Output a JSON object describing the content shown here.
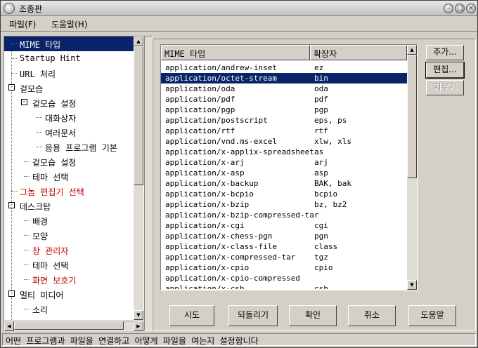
{
  "window": {
    "title": "조종판"
  },
  "menu": [
    "파일(F)",
    "도움말(H)"
  ],
  "tree": [
    {
      "label": "MIME 타입",
      "level": 0,
      "selected": true
    },
    {
      "label": "Startup Hint",
      "level": 0
    },
    {
      "label": "URL 처리",
      "level": 0
    },
    {
      "label": "겉모습",
      "level": 0,
      "expander": "-"
    },
    {
      "label": "겉모습 설정",
      "level": 1,
      "expander": "-"
    },
    {
      "label": "대화상자",
      "level": 2
    },
    {
      "label": "여러문서",
      "level": 2
    },
    {
      "label": "응용 프로그램 기본",
      "level": 2
    },
    {
      "label": "겉모습 설정",
      "level": 1
    },
    {
      "label": "테마 선택",
      "level": 1
    },
    {
      "label": "그놈 편집기 선택",
      "level": 0,
      "red": true
    },
    {
      "label": "데스크탑",
      "level": 0,
      "expander": "-"
    },
    {
      "label": "배경",
      "level": 1
    },
    {
      "label": "모양",
      "level": 1
    },
    {
      "label": "창 관리자",
      "level": 1,
      "red": true
    },
    {
      "label": "테마 선택",
      "level": 1
    },
    {
      "label": "화면 보호기",
      "level": 1,
      "red": true
    },
    {
      "label": "멀티 미디어",
      "level": 0,
      "expander": "-"
    },
    {
      "label": "소리",
      "level": 1
    }
  ],
  "mime_table": {
    "headers": [
      "MIME 타입",
      "확장자"
    ],
    "selected_index": 1,
    "rows": [
      [
        "application/andrew-inset",
        "ez"
      ],
      [
        "application/octet-stream",
        "bin"
      ],
      [
        "application/oda",
        "oda"
      ],
      [
        "application/pdf",
        "pdf"
      ],
      [
        "application/pgp",
        "pgp"
      ],
      [
        "application/postscript",
        "eps, ps"
      ],
      [
        "application/rtf",
        "rtf"
      ],
      [
        "application/vnd.ms-excel",
        "xlw, xls"
      ],
      [
        "application/x-applix-spreadsheet",
        "as"
      ],
      [
        "application/x-arj",
        "arj"
      ],
      [
        "application/x-asp",
        "asp"
      ],
      [
        "application/x-backup",
        "BAK, bak"
      ],
      [
        "application/x-bcpio",
        "bcpio"
      ],
      [
        "application/x-bzip",
        "bz, bz2"
      ],
      [
        "application/x-bzip-compressed-tar",
        ""
      ],
      [
        "application/x-cgi",
        "cgi"
      ],
      [
        "application/x-chess-pgn",
        "pgn"
      ],
      [
        "application/x-class-file",
        "class"
      ],
      [
        "application/x-compressed-tar",
        "tgz"
      ],
      [
        "application/x-cpio",
        "cpio"
      ],
      [
        "application/x-cpio-compressed",
        ""
      ],
      [
        "application/x-csh",
        "csh"
      ]
    ]
  },
  "side_buttons": {
    "add": "추가...",
    "edit": "편집...",
    "delete": "지우기"
  },
  "bottom_buttons": {
    "try": "시도",
    "revert": "되돌리기",
    "ok": "확인",
    "cancel": "취소",
    "help": "도움말"
  },
  "status": "어떤 프로그램과 파일을 연결하고 어떻게 파일을 여는지 설정합니다"
}
